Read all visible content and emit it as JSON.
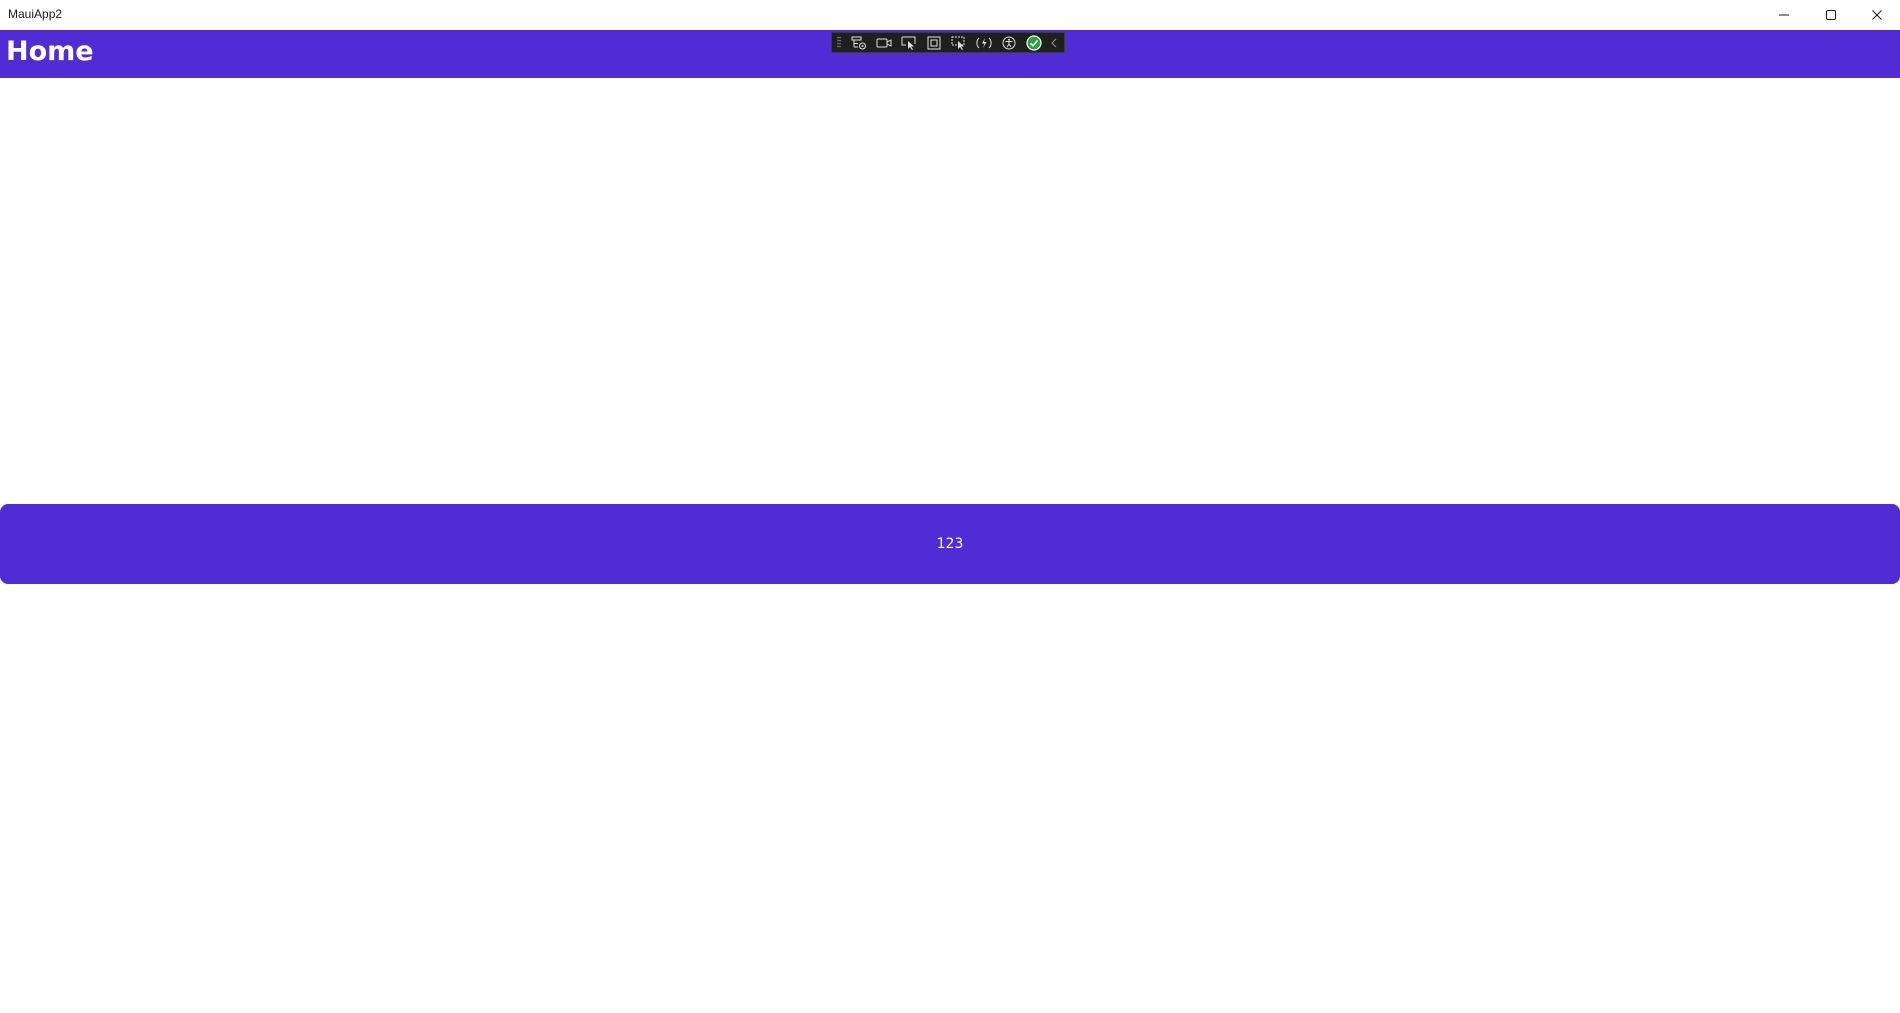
{
  "window": {
    "title": "MauiApp2"
  },
  "navbar": {
    "title": "Home",
    "background": "#512bd4"
  },
  "debug_toolbar": {
    "icons": [
      "live-visual-tree-icon",
      "record-icon",
      "select-element-icon",
      "display-layout-adorners-icon",
      "track-focus-icon",
      "hot-reload-icon",
      "accessibility-icon",
      "binding-check-icon",
      "collapse-chevron-icon"
    ]
  },
  "main": {
    "button_label": "123",
    "button_color": "#512bd4"
  }
}
